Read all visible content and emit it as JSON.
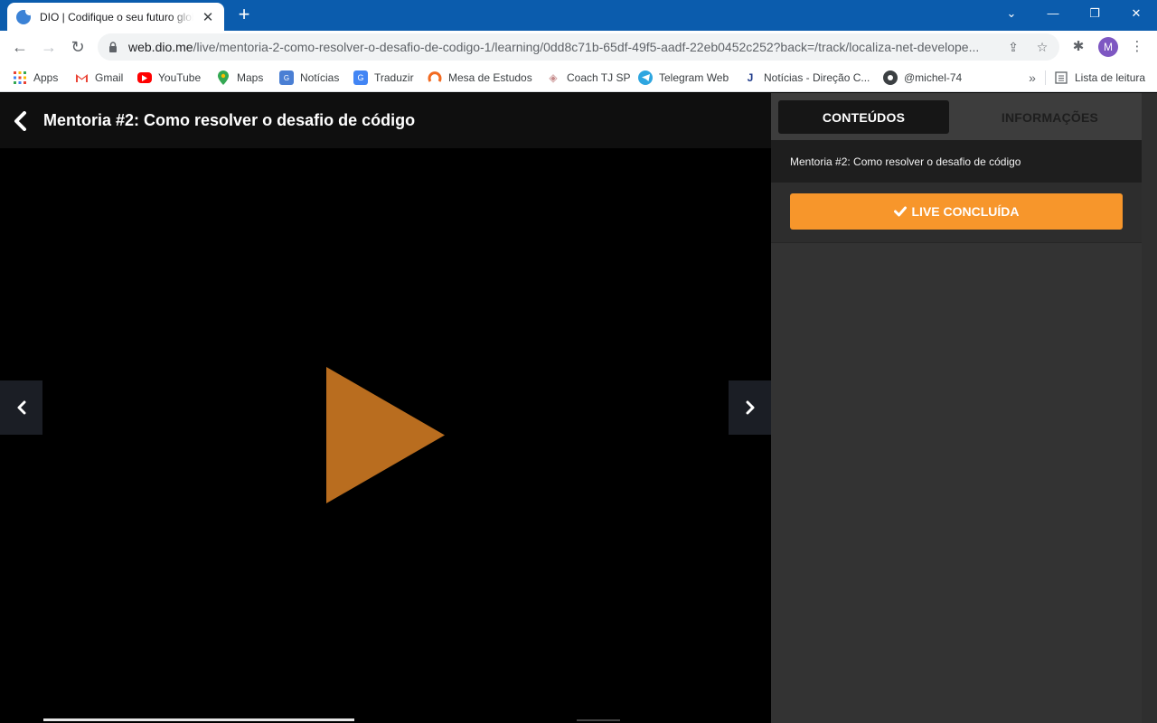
{
  "browser": {
    "tab_title": "DIO | Codifique o seu futuro global",
    "url_host": "web.dio.me",
    "url_path": "/live/mentoria-2-como-resolver-o-desafio-de-codigo-1/learning/0dd8c71b-65df-49f5-aadf-22eb0452c252?back=/track/localiza-net-develope...",
    "profile_initial": "M",
    "bookmarks": [
      {
        "label": "Apps",
        "icon": "apps-grid-icon"
      },
      {
        "label": "Gmail",
        "icon": "gmail-icon"
      },
      {
        "label": "YouTube",
        "icon": "youtube-icon"
      },
      {
        "label": "Maps",
        "icon": "maps-icon"
      },
      {
        "label": "Notícias",
        "icon": "news-icon"
      },
      {
        "label": "Traduzir",
        "icon": "translate-icon"
      },
      {
        "label": "Mesa de Estudos",
        "icon": "mesa-estudos-icon"
      },
      {
        "label": "Coach TJ SP",
        "icon": "coach-icon"
      },
      {
        "label": "Telegram Web",
        "icon": "telegram-icon"
      },
      {
        "label": "Notícias - Direção C...",
        "icon": "direcao-icon"
      },
      {
        "label": "@michel-74",
        "icon": "github-icon"
      }
    ],
    "reading_list": "Lista de leitura"
  },
  "player": {
    "title": "Mentoria #2: Como resolver o desafio de código",
    "play_color": "#b96d1f"
  },
  "sidebar": {
    "tab_contents": "CONTEÚDOS",
    "tab_info": "INFORMAÇÕES",
    "content_item": "Mentoria #2: Como resolver o desafio de código",
    "live_button": "LIVE CONCLUÍDA",
    "accent_color": "#f7962b"
  }
}
